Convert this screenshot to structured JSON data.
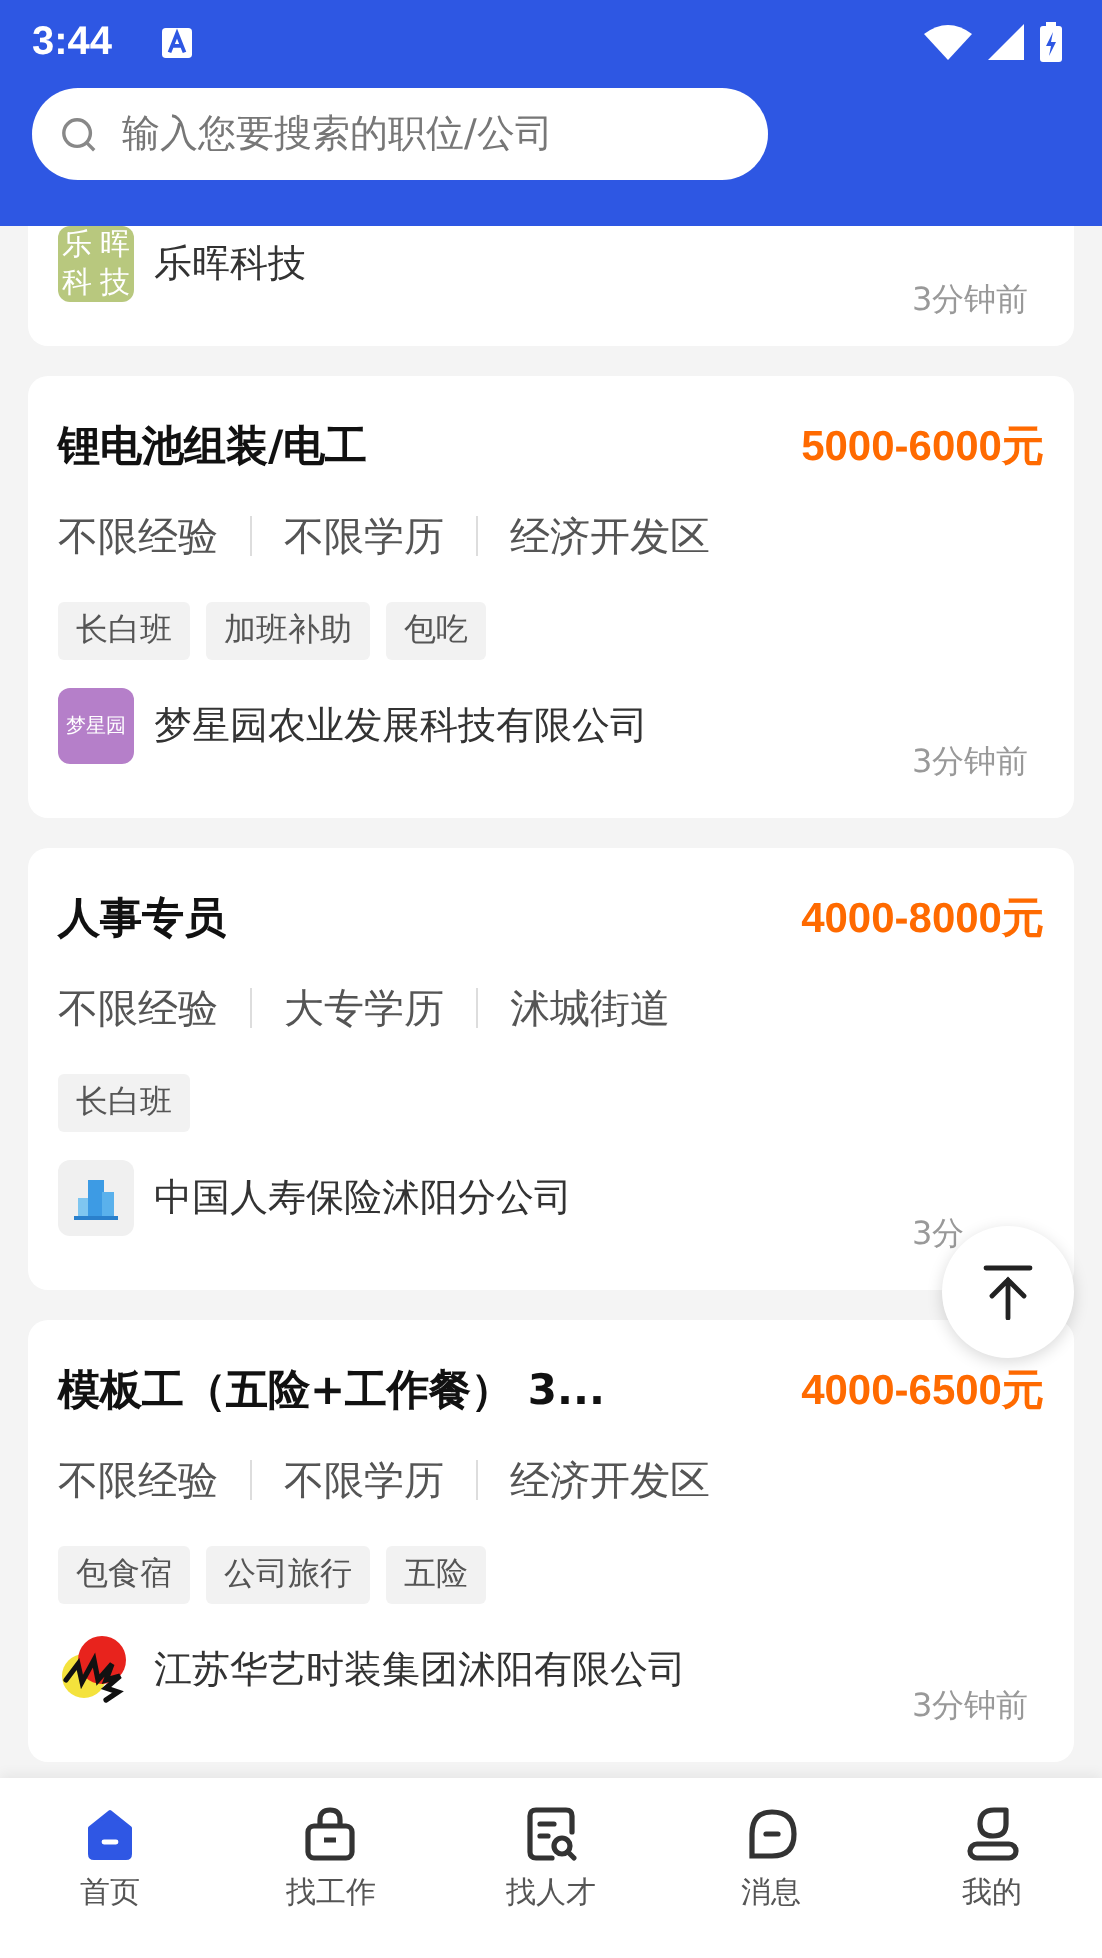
{
  "status_bar": {
    "time": "3:44"
  },
  "search": {
    "placeholder": "输入您要搜索的职位/公司"
  },
  "jobs": [
    {
      "company": "乐晖科技",
      "logo_text": [
        "乐",
        "晖",
        "科",
        "技"
      ],
      "time": "3分钟前",
      "partial": true
    },
    {
      "title": "锂电池组装/电工",
      "salary": "5000-6000",
      "unit": "元",
      "info": [
        "不限经验",
        "不限学历",
        "经济开发区"
      ],
      "tags": [
        "长白班",
        "加班补助",
        "包吃"
      ],
      "company": "梦星园农业发展科技有限公司",
      "logo_text": [
        "梦星园"
      ],
      "time": "3分钟前",
      "partial": false
    },
    {
      "title": "人事专员",
      "salary": "4000-8000",
      "unit": "元",
      "info": [
        "不限经验",
        "大专学历",
        "沭城街道"
      ],
      "tags": [
        "长白班"
      ],
      "company": "中国人寿保险沭阳分公司",
      "time": "3分",
      "partial": false
    },
    {
      "title": "模板工（五险+工作餐） 3...",
      "salary": "4000-6500",
      "unit": "元",
      "info": [
        "不限经验",
        "不限学历",
        "经济开发区"
      ],
      "tags": [
        "包食宿",
        "公司旅行",
        "五险"
      ],
      "company": "江苏华艺时装集团沭阳有限公司",
      "time": "3分钟前",
      "partial": false
    }
  ],
  "nav": [
    {
      "label": "首页",
      "selected": true
    },
    {
      "label": "找工作",
      "selected": false
    },
    {
      "label": "找人才",
      "selected": false
    },
    {
      "label": "消息",
      "selected": false
    },
    {
      "label": "我的",
      "selected": false
    }
  ]
}
